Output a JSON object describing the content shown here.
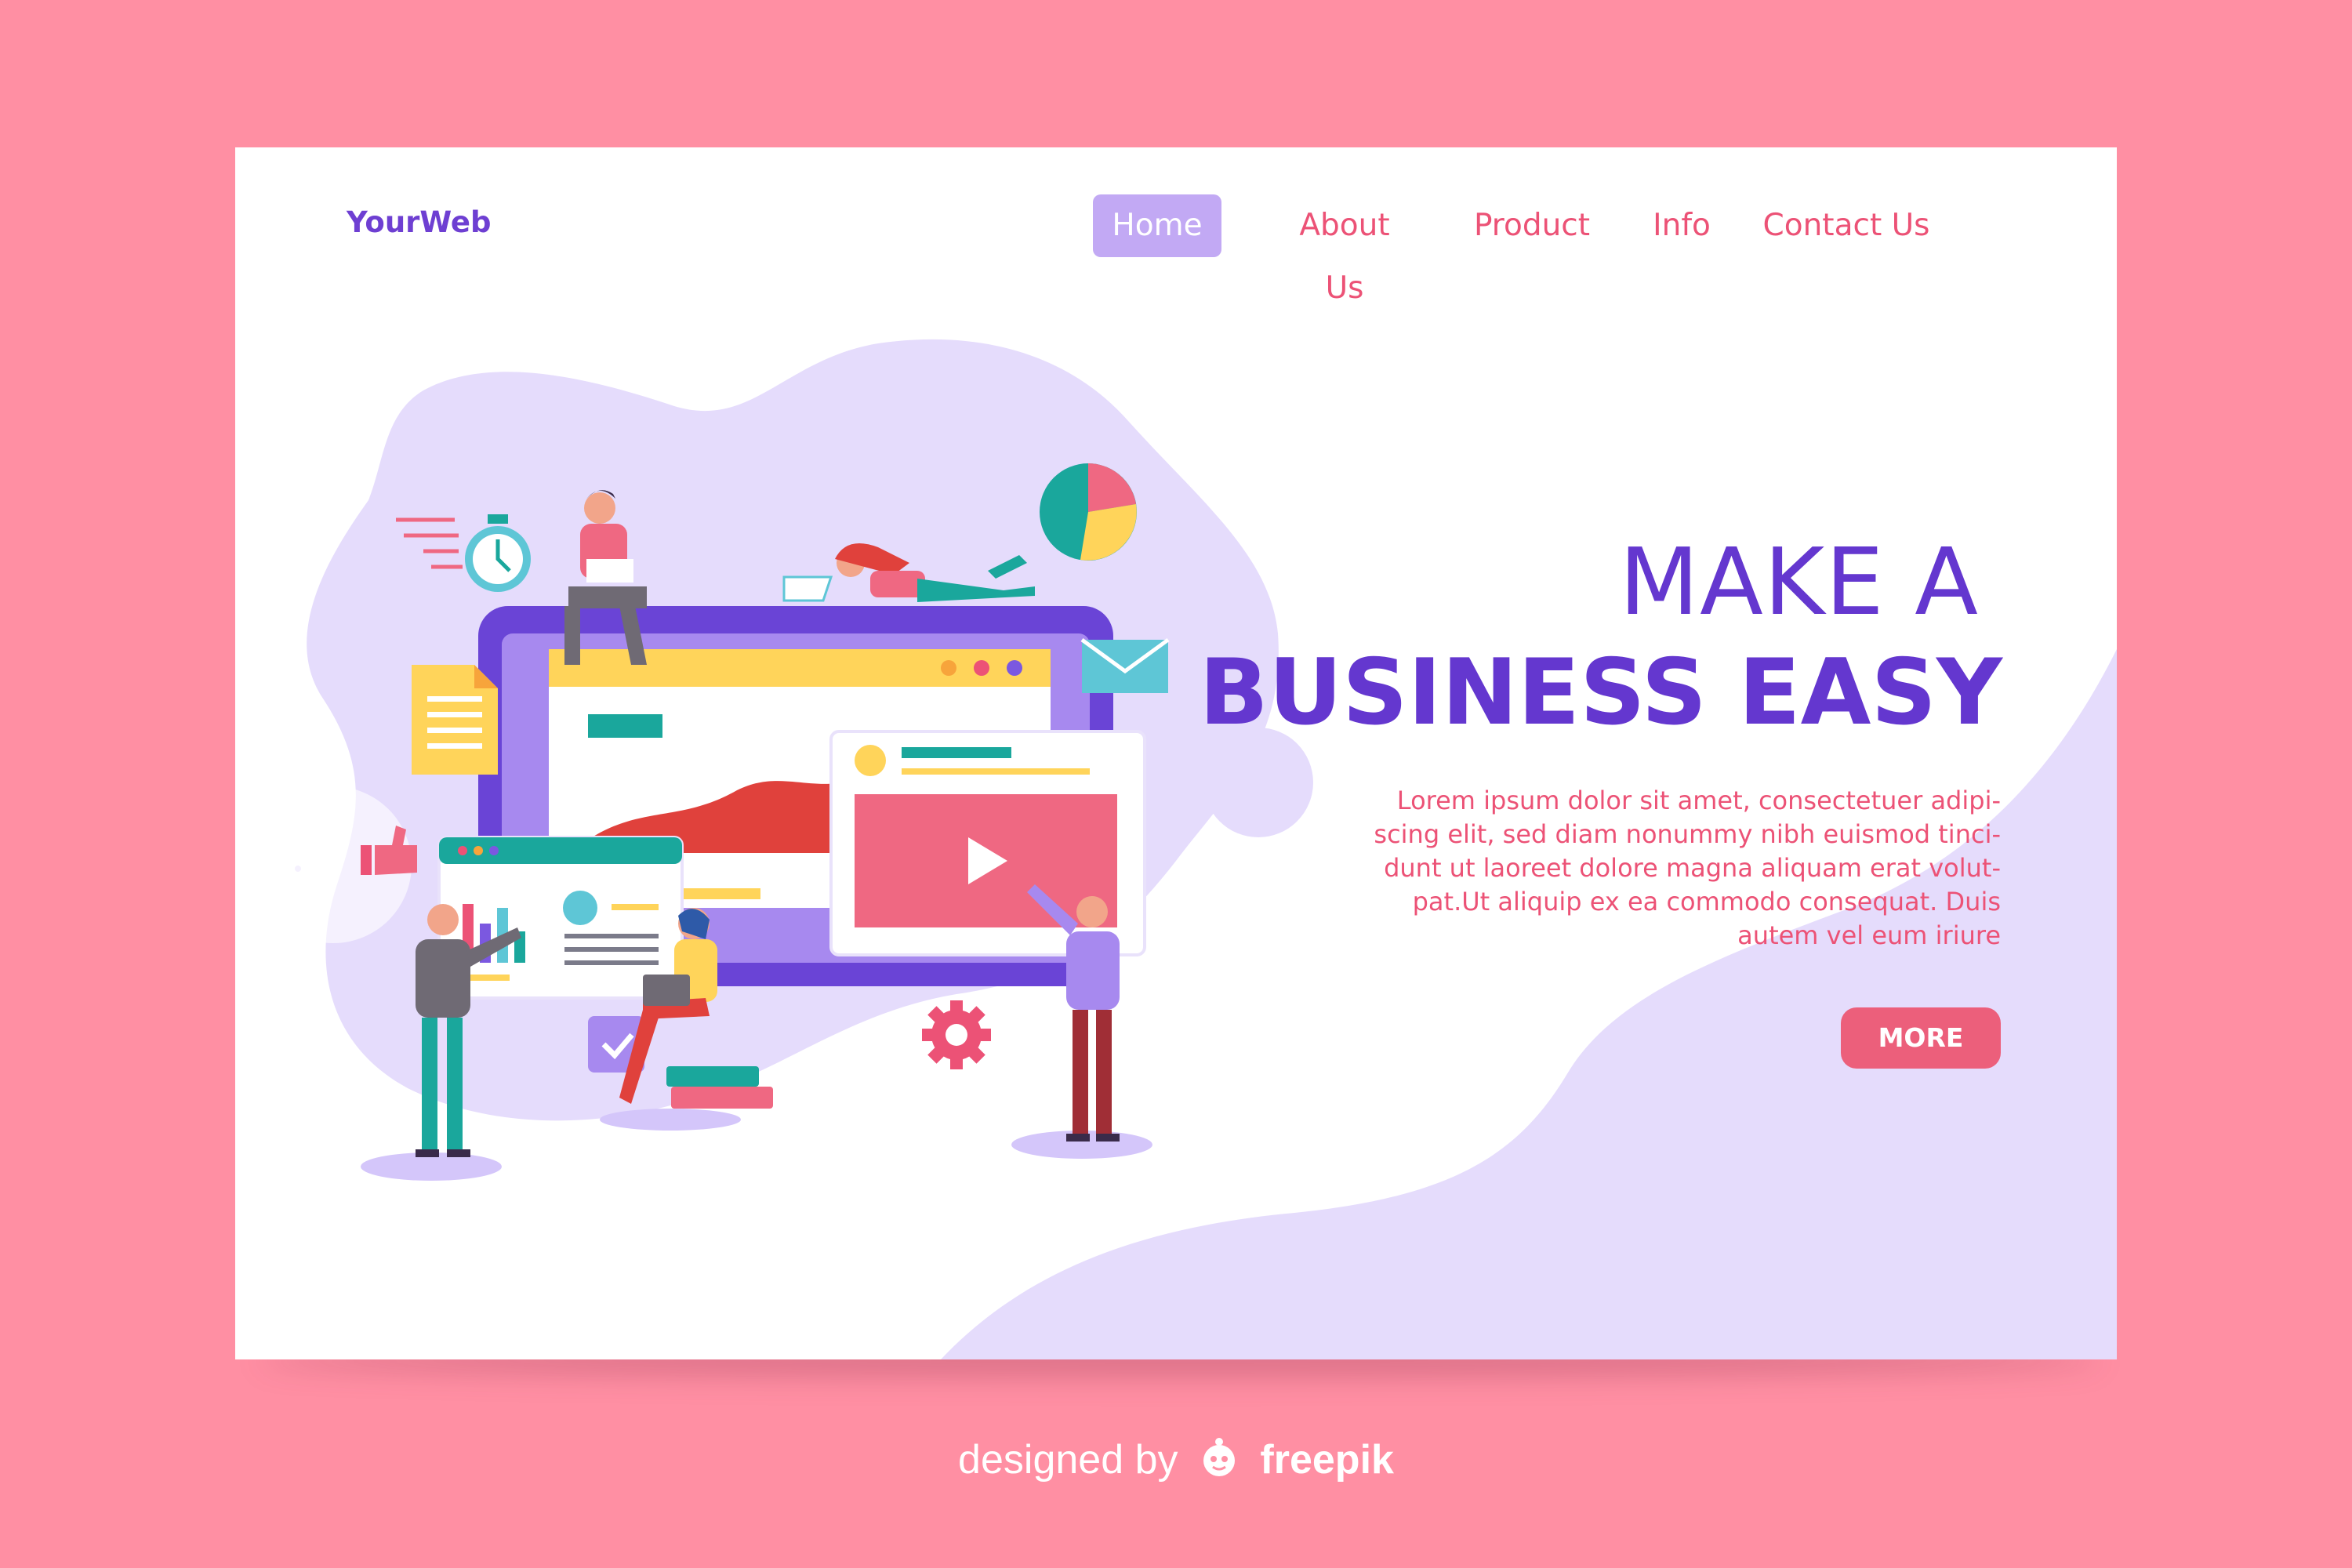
{
  "header": {
    "logo": "YourWeb",
    "nav": [
      "Home",
      "About Us",
      "Product",
      "Info",
      "Contact Us"
    ],
    "active": "Home"
  },
  "hero": {
    "title_line1": "MAKE A",
    "title_line2": "BUSINESS EASY",
    "body": "Lorem ipsum dolor sit amet, consectetuer adipi-scing elit, sed diam nonummy nibh euismod tinci-dunt ut laoreet dolore magna aliquam erat volut-pat.Ut aliquip ex ea commodo consequat. Duis autem vel eum iriure",
    "body_lines": [
      "Lorem ipsum dolor sit amet, consectetuer adipi-",
      "scing elit, sed diam nonummy nibh euismod tinci-",
      "dunt ut laoreet dolore magna aliquam erat volut-",
      "pat.Ut aliquip ex ea commodo consequat. Duis",
      "autem vel eum iriure"
    ],
    "cta_label": "MORE"
  },
  "footer": {
    "credit_prefix": "designed by",
    "credit_brand": "freepik"
  },
  "colors": {
    "background": "#ff8fa3",
    "accent_purple": "#6437cf",
    "accent_pink": "#ec5276",
    "nav_active_bg": "#c2a9f4",
    "blob": "#e5dcfc"
  },
  "illustration_icons": [
    "stopwatch-icon",
    "pie-chart-icon",
    "document-icon",
    "envelope-icon",
    "thumbs-up-icon",
    "checkbox-icon",
    "gear-icon",
    "play-icon"
  ]
}
